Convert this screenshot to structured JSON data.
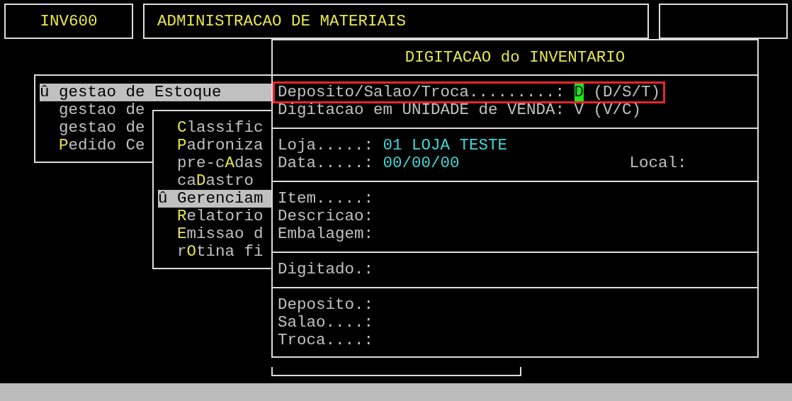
{
  "header": {
    "program_code": "INV600",
    "system_title": "ADMINISTRACAO DE MATERIAIS"
  },
  "main_menu": {
    "items": [
      {
        "before": "û gestao de Estoque",
        "selected": true
      },
      {
        "before": "gestao de",
        "selected": false
      },
      {
        "before": "gestao de",
        "selected": false
      },
      {
        "hotkey": "P",
        "after": "edido Ce",
        "selected": false
      }
    ]
  },
  "submenu": {
    "items": [
      {
        "hotkey": "C",
        "after": "lassific",
        "selected": false
      },
      {
        "hotkey": "P",
        "after": "adroniza",
        "selected": false
      },
      {
        "before": "pre-c",
        "hotkey": "A",
        "after": "das",
        "selected": false
      },
      {
        "before": "ca",
        "hotkey": "D",
        "after": "astro",
        "selected": false
      },
      {
        "before": "û Gerenciam",
        "selected": true
      },
      {
        "hotkey": "R",
        "after": "elatorio",
        "selected": false
      },
      {
        "hotkey": "E",
        "after": "missao d",
        "selected": false
      },
      {
        "before": "r",
        "hotkey": "O",
        "after": "tina fi",
        "selected": false
      }
    ]
  },
  "dialog": {
    "title": "DIGITACAO do INVENTARIO",
    "sections": [
      {
        "rows": [
          [
            {
              "kind": "choice",
              "label": "Deposito/Salao/Troca.........:",
              "value": "D",
              "options": "(D/S/T)",
              "focused": true,
              "annotated": true
            }
          ],
          [
            {
              "kind": "choice",
              "label": "Digitacao em UNIDADE de VENDA:",
              "value": "V",
              "options": "(V/C)",
              "focused": false,
              "annotated": false
            }
          ]
        ]
      },
      {
        "rows": [
          [
            {
              "kind": "display",
              "label": "Loja.....:",
              "value": "01 LOJA TESTE"
            }
          ],
          [
            {
              "kind": "display",
              "label": "Data.....:",
              "value": "00/00/00"
            },
            {
              "kind": "empty",
              "label": "Local:"
            }
          ]
        ]
      },
      {
        "rows": [
          [
            {
              "kind": "empty",
              "label": "Item.....:"
            }
          ],
          [
            {
              "kind": "empty",
              "label": "Descricao:"
            }
          ],
          [
            {
              "kind": "empty",
              "label": "Embalagem:"
            }
          ]
        ]
      },
      {
        "rows": [
          [
            {
              "kind": "empty",
              "label": "Digitado.:"
            }
          ]
        ]
      },
      {
        "rows": [
          [
            {
              "kind": "empty",
              "label": "Deposito.:"
            }
          ],
          [
            {
              "kind": "empty",
              "label": "Salao....:"
            }
          ],
          [
            {
              "kind": "empty",
              "label": "Troca....:"
            }
          ]
        ]
      }
    ]
  }
}
